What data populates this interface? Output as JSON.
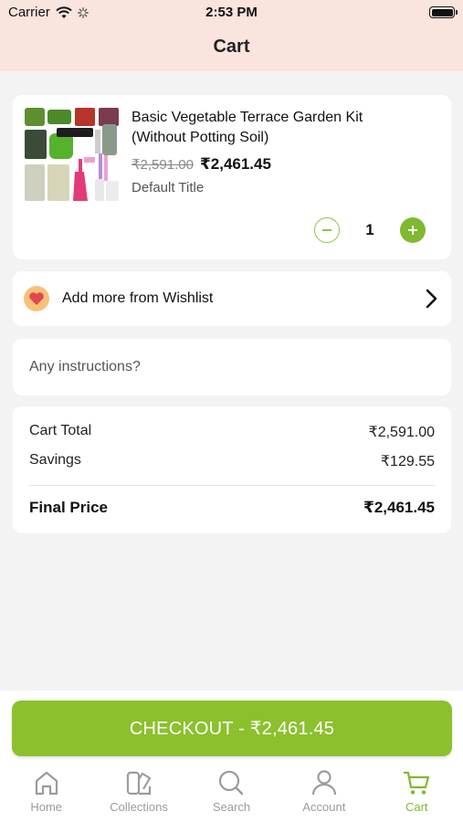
{
  "status_bar": {
    "carrier": "Carrier",
    "time": "2:53 PM"
  },
  "header": {
    "title": "Cart"
  },
  "cart_item": {
    "name": "Basic Vegetable Terrace Garden Kit (Without Potting Soil)",
    "original_price": "₹2,591.00",
    "price": "₹2,461.45",
    "variant": "Default Title",
    "quantity": "1"
  },
  "wishlist": {
    "label": "Add more from Wishlist"
  },
  "instructions": {
    "placeholder": "Any instructions?"
  },
  "summary": {
    "cart_total_label": "Cart Total",
    "cart_total_value": "₹2,591.00",
    "savings_label": "Savings",
    "savings_value": "₹129.55",
    "final_label": "Final Price",
    "final_value": "₹2,461.45"
  },
  "checkout": {
    "label": "CHECKOUT - ₹2,461.45"
  },
  "tabs": [
    {
      "label": "Home",
      "icon": "home-icon"
    },
    {
      "label": "Collections",
      "icon": "collections-icon"
    },
    {
      "label": "Search",
      "icon": "search-icon"
    },
    {
      "label": "Account",
      "icon": "account-icon"
    },
    {
      "label": "Cart",
      "icon": "cart-icon"
    }
  ],
  "colors": {
    "accent": "#8dc02d",
    "header_bg": "#f9e4de",
    "inactive_tab": "#9b9b9b"
  }
}
